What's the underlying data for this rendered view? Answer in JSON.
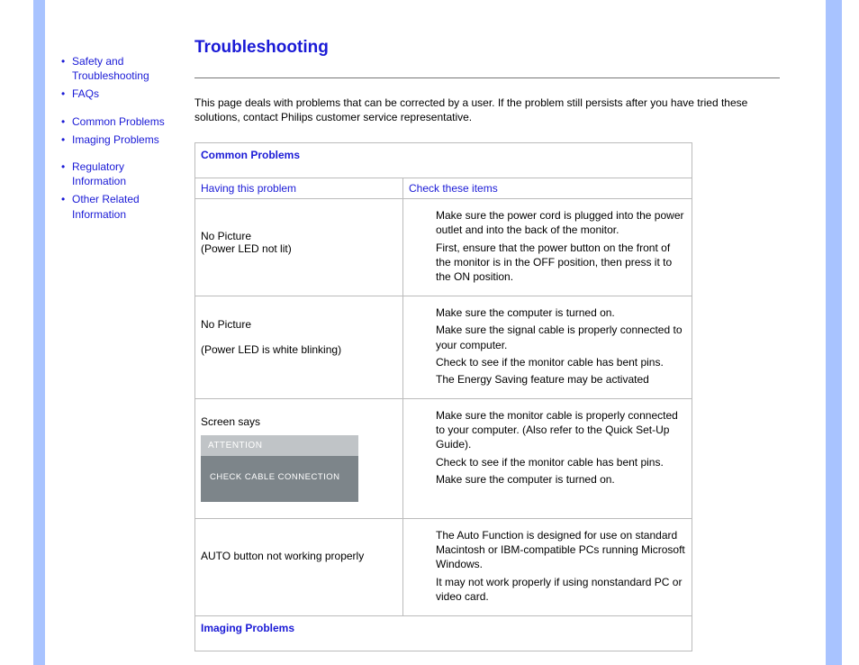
{
  "sidebar": {
    "items": [
      {
        "label": "Safety and Troubleshooting"
      },
      {
        "label": "FAQs"
      },
      {
        "label": "Common Problems"
      },
      {
        "label": "Imaging Problems"
      },
      {
        "label": "Regulatory Information"
      },
      {
        "label": "Other Related Information"
      }
    ]
  },
  "page": {
    "title": "Troubleshooting",
    "intro": "This page deals with problems that can be corrected by a user. If the problem still persists after you have tried these solutions, contact Philips customer service representative."
  },
  "table": {
    "section1_title": "Common Problems",
    "col1_head": "Having this problem",
    "col2_head": "Check these items",
    "rows": [
      {
        "problem_line1": "No Picture",
        "problem_line2": "(Power LED not lit)",
        "sol1": "Make sure the power cord is plugged into the power outlet and into the back of the monitor.",
        "sol2": "First, ensure that the power button on the front of the monitor is in the OFF position, then press it to the ON position."
      },
      {
        "problem_line1": "No Picture",
        "problem_line2": "(Power LED is white blinking)",
        "sol1": "Make sure the computer is turned on.",
        "sol2": "Make sure the signal cable is properly connected to your computer.",
        "sol3": "Check to see if the monitor cable has bent pins.",
        "sol4": "The Energy Saving feature may be activated"
      },
      {
        "problem_line1": "Screen says",
        "attn_label": "ATTENTION",
        "attn_msg": "CHECK CABLE CONNECTION",
        "sol1": "Make sure the monitor cable is properly connected to your computer. (Also refer to the Quick Set-Up Guide).",
        "sol2": "Check to see if the monitor cable has bent pins.",
        "sol3": "Make sure the computer is turned on."
      },
      {
        "problem_line1": "AUTO button not working properly",
        "sol1": "The Auto Function is designed for use on standard Macintosh or IBM-compatible PCs running Microsoft Windows.",
        "sol2": "It may not work properly if using nonstandard PC or video card."
      }
    ],
    "section2_title": "Imaging Problems"
  }
}
